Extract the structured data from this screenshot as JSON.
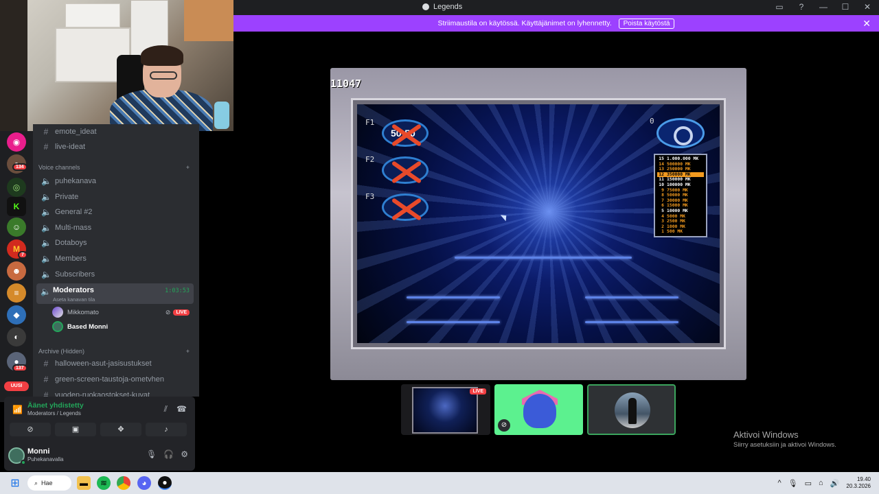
{
  "window": {
    "title": "Legends",
    "controls": [
      "▭",
      "?",
      "—",
      "☐",
      "✕"
    ]
  },
  "banner": {
    "text": "Striimaustila on käytössä. Käyttäjänimet on lyhennetty.",
    "button": "Poista käytöstä",
    "close": "✕"
  },
  "channels": {
    "text_top": [
      {
        "name": "emote_ideat"
      },
      {
        "name": "live-ideat"
      }
    ],
    "voice_category": "Voice channels",
    "voice": [
      {
        "name": "puhekanava"
      },
      {
        "name": "Private"
      },
      {
        "name": "General #2"
      },
      {
        "name": "Multi-mass"
      },
      {
        "name": "Dotaboys"
      },
      {
        "name": "Members"
      },
      {
        "name": "Subscribers"
      }
    ],
    "active": {
      "name": "Moderators",
      "subtitle": "Aseta kanavan tila",
      "time": "1:03:53"
    },
    "voice_users": [
      {
        "name": "Mikkomato",
        "live": "LIVE"
      },
      {
        "name": "Based Monni"
      }
    ],
    "archive_category": "Archive (Hidden)",
    "archive": [
      {
        "name": "halloween-asut-jasisustukset"
      },
      {
        "name": "green-screen-taustoja-ometvhen"
      },
      {
        "name": "vuoden-ruokaostokset-kuvat"
      }
    ]
  },
  "server_badges": {
    "a": "134",
    "b": "7",
    "c": "137",
    "new": "UUSI"
  },
  "voice_panel": {
    "status": "Äänet yhdistetty",
    "location": "Moderators / Legends"
  },
  "user": {
    "name": "Monni",
    "status": "Puhekanavalla"
  },
  "stream": {
    "counter": "11047",
    "lifelines": [
      {
        "key": "F1",
        "label": "50:50"
      },
      {
        "key": "F2",
        "label": ""
      },
      {
        "key": "F3",
        "label": ""
      }
    ],
    "eye_value": "0",
    "ladder": [
      {
        "n": "15",
        "amt": "1.000.000 MK",
        "style": "white"
      },
      {
        "n": "14",
        "amt": "500000 MK",
        "style": "orange"
      },
      {
        "n": "13",
        "amt": "250000 MK",
        "style": "orange"
      },
      {
        "n": "12",
        "amt": "350000 MK",
        "style": "sel"
      },
      {
        "n": "11",
        "amt": "150000 MK",
        "style": "white"
      },
      {
        "n": "10",
        "amt": "100000 MK",
        "style": "white"
      },
      {
        "n": "9",
        "amt": "75000 MK",
        "style": "orange"
      },
      {
        "n": "8",
        "amt": "50000 MK",
        "style": "orange"
      },
      {
        "n": "7",
        "amt": "30000 MK",
        "style": "orange"
      },
      {
        "n": "6",
        "amt": "15000 MK",
        "style": "orange"
      },
      {
        "n": "5",
        "amt": "10000 MK",
        "style": "white"
      },
      {
        "n": "4",
        "amt": "5000 MK",
        "style": "orange"
      },
      {
        "n": "3",
        "amt": "2500 MK",
        "style": "orange"
      },
      {
        "n": "2",
        "amt": "1000 MK",
        "style": "orange"
      },
      {
        "n": "1",
        "amt": "500 MK",
        "style": "orange"
      }
    ]
  },
  "thumbs": {
    "live": "LIVE"
  },
  "activate": {
    "title": "Aktivoi Windows",
    "subtitle": "Siirry asetuksiin ja aktivoi Windows."
  },
  "taskbar": {
    "search": "Hae",
    "time": "19.40",
    "date": "20.3.2026"
  }
}
